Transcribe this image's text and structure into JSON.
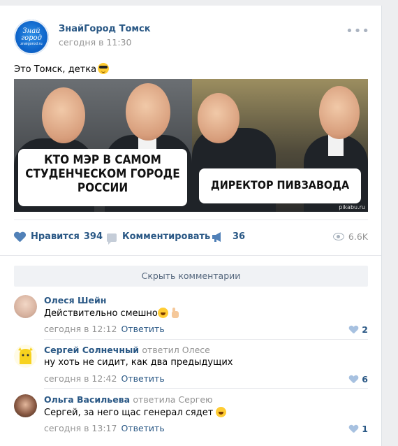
{
  "post": {
    "author": "ЗнайГород Томск",
    "time": "сегодня в 11:30",
    "text": "Это Томск, детка",
    "avatar_logo": "Знай город",
    "avatar_sub": "znaigorod.ru",
    "more_icon": "more-dots-icon"
  },
  "meme": {
    "left_caption": "КТО МЭР В САМОМ СТУДЕНЧЕСКОМ ГОРОДЕ РОССИИ",
    "right_caption": "ДИРЕКТОР ПИВЗАВОДА",
    "watermark": "pikabu.ru"
  },
  "actions": {
    "like_label": "Нравится",
    "like_count": "394",
    "comment_label": "Комментировать",
    "share_count": "36",
    "views": "6.6K"
  },
  "comments_toggle": "Скрыть комментарии",
  "comments": [
    {
      "name": "Олеся Шейн",
      "reply_to": "",
      "text": "Действительно смешно",
      "time": "сегодня в 12:12",
      "reply_label": "Ответить",
      "likes": "2"
    },
    {
      "name": "Сергей Солнечный",
      "reply_to": "ответил Олесе",
      "text": "ну хоть не сидит, как два предыдущих",
      "time": "сегодня в 12:42",
      "reply_label": "Ответить",
      "likes": "6"
    },
    {
      "name": "Ольга Васильева",
      "reply_to": "ответила Сергею",
      "text": "Сергей, за него щас генерал сядет",
      "time": "сегодня в 13:17",
      "reply_label": "Ответить",
      "likes": "1"
    }
  ],
  "colors": {
    "link": "#2a5885",
    "muted": "#939393",
    "accent": "#5181b8",
    "background": "#edeef0"
  }
}
